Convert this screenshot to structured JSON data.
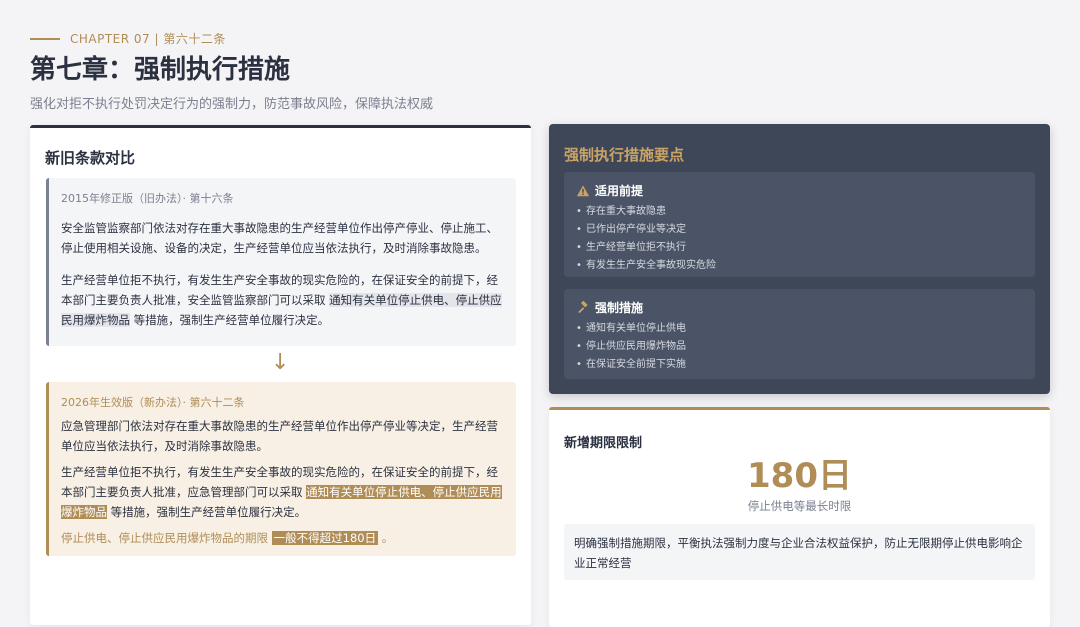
{
  "header": {
    "eyebrow": "CHAPTER 07 | 第六十二条",
    "title": "第七章：强制执行措施",
    "subtitle": "强化对拒不执行处罚决定行为的强制力，防范事故风险，保障执法权威"
  },
  "comparison": {
    "title": "新旧条款对比",
    "arrow": "↓",
    "old": {
      "meta": "2015年修正版（旧办法）· 第十六条",
      "p1": "安全监管监察部门依法对存在重大事故隐患的生产经营单位作出停产停业、停止施工、停止使用相关设施、设备的决定，生产经营单位应当依法执行，及时消除事故隐患。",
      "p2_before": "生产经营单位拒不执行，有发生生产安全事故的现实危险的，在保证安全的前提下，经本部门主要负责人批准，安全监管监察部门可以采取",
      "p2_highlight": "通知有关单位停止供电、停止供应民用爆炸物品",
      "p2_after": "等措施，强制生产经营单位履行决定。"
    },
    "new": {
      "meta": "2026年生效版（新办法）· 第六十二条",
      "p1": "应急管理部门依法对存在重大事故隐患的生产经营单位作出停产停业等决定，生产经营单位应当依法执行，及时消除事故隐患。",
      "p2_before": "生产经营单位拒不执行，有发生生产安全事故的现实危险的，在保证安全的前提下，经本部门主要负责人批准，应急管理部门可以采取",
      "p2_highlight": "通知有关单位停止供电、停止供应民用爆炸物品",
      "p2_after": "等措施，强制生产经营单位履行决定。",
      "p3_before": "停止供电、停止供应民用爆炸物品的期限",
      "p3_highlight": "一般不得超过180日",
      "p3_after": "。"
    }
  },
  "measures": {
    "title": "强制执行措施要点",
    "premise": {
      "label": "适用前提",
      "icon": "warning-icon",
      "items": [
        "存在重大事故隐患",
        "已作出停产停业等决定",
        "生产经营单位拒不执行",
        "有发生生产安全事故现实危险"
      ]
    },
    "actions": {
      "label": "强制措施",
      "icon": "gavel-icon",
      "items": [
        "通知有关单位停止供电",
        "停止供应民用爆炸物品",
        "在保证安全前提下实施"
      ]
    }
  },
  "limit": {
    "title": "新增期限限制",
    "value": "180日",
    "caption": "停止供电等最长时限",
    "note": "明确强制措施期限，平衡执法强制力度与企业合法权益保护，防止无限期停止供电影响企业正常经营"
  },
  "colors": {
    "gold": "#b08d57",
    "navy": "#2b3140",
    "dark_card": "#3e4758"
  }
}
